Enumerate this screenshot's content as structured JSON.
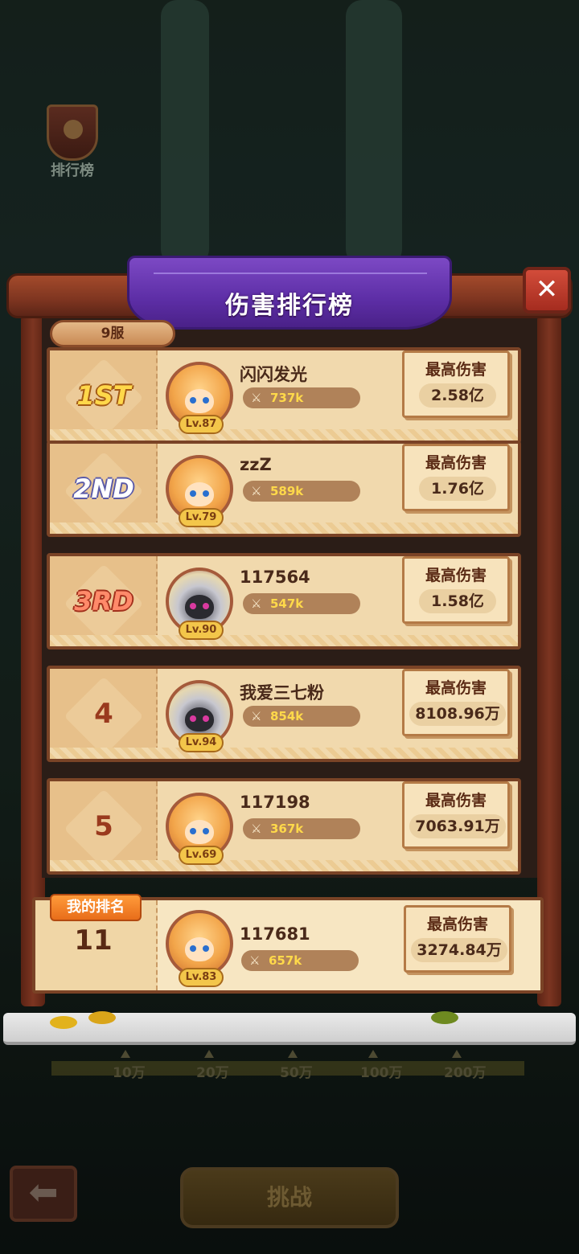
{
  "hud": {
    "rank_label": "排行榜"
  },
  "board": {
    "title": "伤害排行榜",
    "server": "9服",
    "close_symbol": "✕"
  },
  "entries": [
    {
      "rank": "1ST",
      "name": "闪闪发光",
      "level": "Lv.87",
      "power": "737k",
      "dmg_label": "最高伤害",
      "dmg": "2.58亿"
    },
    {
      "rank": "2ND",
      "name": "zzZ",
      "level": "Lv.79",
      "power": "589k",
      "dmg_label": "最高伤害",
      "dmg": "1.76亿"
    },
    {
      "rank": "3RD",
      "name": "117564",
      "level": "Lv.90",
      "power": "547k",
      "dmg_label": "最高伤害",
      "dmg": "1.58亿"
    },
    {
      "rank": "4",
      "name": "我爱三七粉",
      "level": "Lv.94",
      "power": "854k",
      "dmg_label": "最高伤害",
      "dmg": "8108.96万"
    },
    {
      "rank": "5",
      "name": "117198",
      "level": "Lv.69",
      "power": "367k",
      "dmg_label": "最高伤害",
      "dmg": "7063.91万"
    }
  ],
  "mine": {
    "tag": "我的排名",
    "rank": "11",
    "name": "117681",
    "level": "Lv.83",
    "power": "657k",
    "dmg_label": "最高伤害",
    "dmg": "3274.84万"
  },
  "scale": [
    "10万",
    "20万",
    "50万",
    "100万",
    "200万"
  ],
  "buttons": {
    "back": "⬅",
    "challenge": "挑战"
  },
  "icons": {
    "sword": "⚔"
  }
}
